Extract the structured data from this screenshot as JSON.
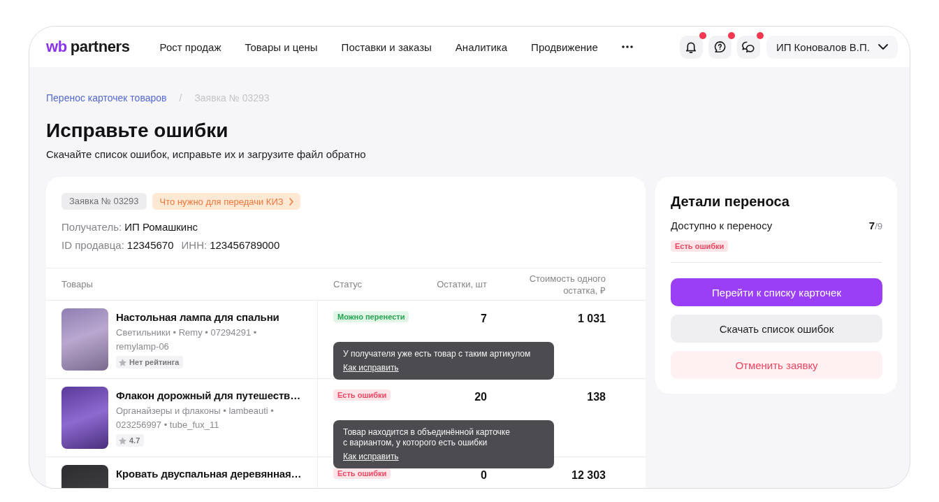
{
  "header": {
    "logo": {
      "mark": "wb",
      "name": "partners"
    },
    "nav": [
      {
        "label": "Рост продаж"
      },
      {
        "label": "Товары и цены"
      },
      {
        "label": "Поставки и заказы"
      },
      {
        "label": "Аналитика"
      },
      {
        "label": "Продвижение"
      }
    ],
    "icon_buttons": [
      {
        "kind": "notifications",
        "unread": true
      },
      {
        "kind": "support",
        "unread": true
      },
      {
        "kind": "chat",
        "unread": true
      }
    ],
    "account": {
      "name": "ИП Коновалов В.П."
    }
  },
  "breadcrumbs": {
    "separator": "/",
    "items": [
      {
        "label": "Перенос карточек товаров",
        "current": false
      },
      {
        "label": "Заявка № 03293",
        "current": true
      }
    ]
  },
  "page": {
    "title": "Исправьте ошибки",
    "subtitle": "Скачайте список ошибок, исправьте их и загрузите файл обратно"
  },
  "request": {
    "tags": [
      {
        "kind": "number",
        "label": "Заявка № 03293"
      },
      {
        "kind": "link",
        "label": "Что нужно для передачи КИЗ"
      }
    ],
    "info_lines": [
      {
        "fields": [
          {
            "label": "Получатель:",
            "value": "ИП Ромашкинс"
          }
        ]
      },
      {
        "fields": [
          {
            "label": "ID продавца:",
            "value": "12345670"
          },
          {
            "label": "ИНН:",
            "value": "123456789000"
          }
        ]
      }
    ]
  },
  "table": {
    "columns": [
      "Товары",
      "Статус",
      "Остатки, шт",
      "Стоимость одного остатка, ₽"
    ],
    "rows": [
      {
        "title": "Настольная лампа для спальни",
        "meta": "Светильники • Remy • 07294291 •\nremylamp-06",
        "rating": "Нет рейтинга",
        "status": {
          "kind": "ok",
          "label": "Можно перенести"
        },
        "stock": "7",
        "price": "1 031",
        "tooltip": {
          "text": "У получателя уже есть товар с таким артикулом",
          "link": "Как исправить"
        }
      },
      {
        "title": "Флакон дорожный для путешеств…",
        "meta": "Органайзеры и флаконы • lambeauti •\n023256997 • tube_fux_11",
        "rating": "4.7",
        "status": {
          "kind": "error",
          "label": "Есть ошибки"
        },
        "stock": "20",
        "price": "138",
        "tooltip": {
          "text": "Товар находится в объединённой карточке\nс вариантом, у которого есть ошибки",
          "link": "Как исправить"
        }
      },
      {
        "title": "Кровать двуспальная деревянная…",
        "status": {
          "kind": "error",
          "label": "Есть ошибки"
        },
        "stock": "0",
        "price": "12 303"
      }
    ]
  },
  "details": {
    "title": "Детали переноса",
    "available": {
      "label": "Доступно к переносу",
      "count": "7",
      "total": "/9"
    },
    "status": {
      "kind": "error",
      "label": "Есть ошибки"
    },
    "actions": [
      {
        "kind": "primary",
        "label": "Перейти к списку карточек"
      },
      {
        "kind": "secondary",
        "label": "Скачать список ошибок"
      },
      {
        "kind": "danger",
        "label": "Отменить заявку"
      }
    ]
  }
}
